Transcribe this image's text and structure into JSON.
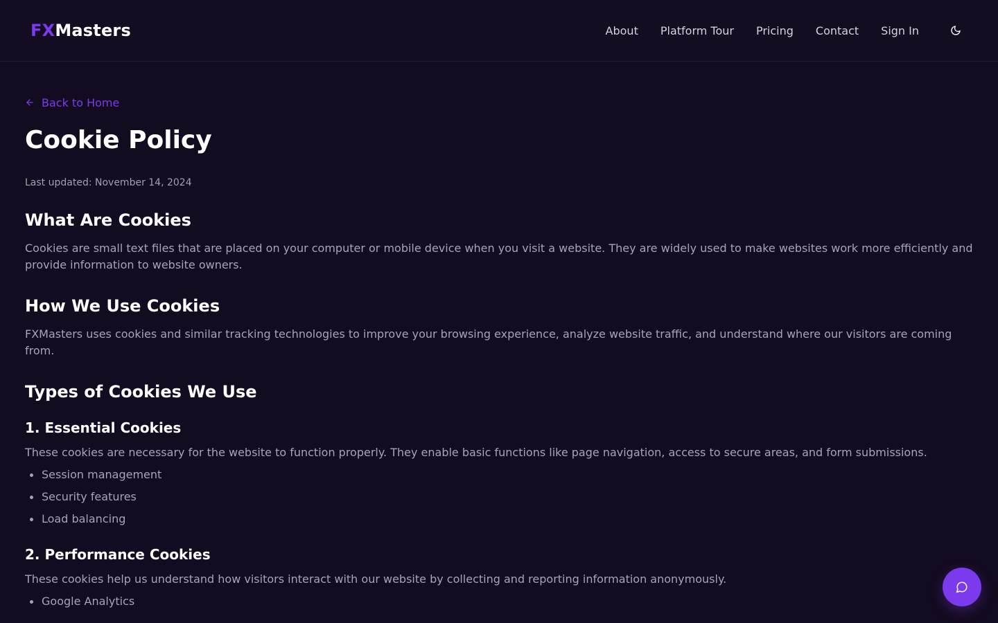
{
  "header": {
    "logo_fx": "FX",
    "logo_masters": "Masters",
    "nav": [
      "About",
      "Platform Tour",
      "Pricing",
      "Contact",
      "Sign In"
    ],
    "theme_toggle_icon": "moon-icon"
  },
  "main": {
    "back_label": "Back to Home",
    "title": "Cookie Policy",
    "updated": "Last updated: November 14, 2024",
    "sections": {
      "what_heading": "What Are Cookies",
      "what_body": "Cookies are small text files that are placed on your computer or mobile device when you visit a website. They are widely used to make websites work more efficiently and provide information to website owners.",
      "how_heading": "How We Use Cookies",
      "how_body": "FXMasters uses cookies and similar tracking technologies to improve your browsing experience, analyze website traffic, and understand where our visitors are coming from.",
      "types_heading": "Types of Cookies We Use",
      "essential_heading": "1. Essential Cookies",
      "essential_body": "These cookies are necessary for the website to function properly. They enable basic functions like page navigation, access to secure areas, and form submissions.",
      "essential_items": [
        "Session management",
        "Security features",
        "Load balancing"
      ],
      "performance_heading": "2. Performance Cookies",
      "performance_body": "These cookies help us understand how visitors interact with our website by collecting and reporting information anonymously.",
      "performance_items": [
        "Google Analytics"
      ]
    }
  },
  "chat": {
    "icon": "chat-bubble-icon"
  },
  "colors": {
    "accent": "#7c3aed",
    "background": "#130b1f",
    "body_text": "#a9a3b8"
  }
}
